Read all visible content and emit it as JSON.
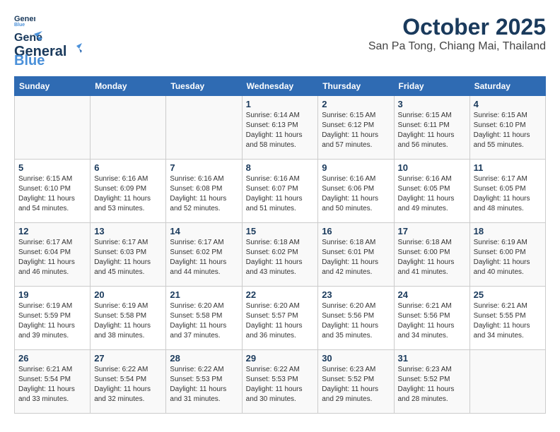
{
  "header": {
    "logo_line1": "General",
    "logo_line2": "Blue",
    "title": "October 2025",
    "subtitle": "San Pa Tong, Chiang Mai, Thailand"
  },
  "calendar": {
    "days_of_week": [
      "Sunday",
      "Monday",
      "Tuesday",
      "Wednesday",
      "Thursday",
      "Friday",
      "Saturday"
    ],
    "weeks": [
      [
        {
          "day": "",
          "info": ""
        },
        {
          "day": "",
          "info": ""
        },
        {
          "day": "",
          "info": ""
        },
        {
          "day": "1",
          "info": "Sunrise: 6:14 AM\nSunset: 6:13 PM\nDaylight: 11 hours\nand 58 minutes."
        },
        {
          "day": "2",
          "info": "Sunrise: 6:15 AM\nSunset: 6:12 PM\nDaylight: 11 hours\nand 57 minutes."
        },
        {
          "day": "3",
          "info": "Sunrise: 6:15 AM\nSunset: 6:11 PM\nDaylight: 11 hours\nand 56 minutes."
        },
        {
          "day": "4",
          "info": "Sunrise: 6:15 AM\nSunset: 6:10 PM\nDaylight: 11 hours\nand 55 minutes."
        }
      ],
      [
        {
          "day": "5",
          "info": "Sunrise: 6:15 AM\nSunset: 6:10 PM\nDaylight: 11 hours\nand 54 minutes."
        },
        {
          "day": "6",
          "info": "Sunrise: 6:16 AM\nSunset: 6:09 PM\nDaylight: 11 hours\nand 53 minutes."
        },
        {
          "day": "7",
          "info": "Sunrise: 6:16 AM\nSunset: 6:08 PM\nDaylight: 11 hours\nand 52 minutes."
        },
        {
          "day": "8",
          "info": "Sunrise: 6:16 AM\nSunset: 6:07 PM\nDaylight: 11 hours\nand 51 minutes."
        },
        {
          "day": "9",
          "info": "Sunrise: 6:16 AM\nSunset: 6:06 PM\nDaylight: 11 hours\nand 50 minutes."
        },
        {
          "day": "10",
          "info": "Sunrise: 6:16 AM\nSunset: 6:05 PM\nDaylight: 11 hours\nand 49 minutes."
        },
        {
          "day": "11",
          "info": "Sunrise: 6:17 AM\nSunset: 6:05 PM\nDaylight: 11 hours\nand 48 minutes."
        }
      ],
      [
        {
          "day": "12",
          "info": "Sunrise: 6:17 AM\nSunset: 6:04 PM\nDaylight: 11 hours\nand 46 minutes."
        },
        {
          "day": "13",
          "info": "Sunrise: 6:17 AM\nSunset: 6:03 PM\nDaylight: 11 hours\nand 45 minutes."
        },
        {
          "day": "14",
          "info": "Sunrise: 6:17 AM\nSunset: 6:02 PM\nDaylight: 11 hours\nand 44 minutes."
        },
        {
          "day": "15",
          "info": "Sunrise: 6:18 AM\nSunset: 6:02 PM\nDaylight: 11 hours\nand 43 minutes."
        },
        {
          "day": "16",
          "info": "Sunrise: 6:18 AM\nSunset: 6:01 PM\nDaylight: 11 hours\nand 42 minutes."
        },
        {
          "day": "17",
          "info": "Sunrise: 6:18 AM\nSunset: 6:00 PM\nDaylight: 11 hours\nand 41 minutes."
        },
        {
          "day": "18",
          "info": "Sunrise: 6:19 AM\nSunset: 6:00 PM\nDaylight: 11 hours\nand 40 minutes."
        }
      ],
      [
        {
          "day": "19",
          "info": "Sunrise: 6:19 AM\nSunset: 5:59 PM\nDaylight: 11 hours\nand 39 minutes."
        },
        {
          "day": "20",
          "info": "Sunrise: 6:19 AM\nSunset: 5:58 PM\nDaylight: 11 hours\nand 38 minutes."
        },
        {
          "day": "21",
          "info": "Sunrise: 6:20 AM\nSunset: 5:58 PM\nDaylight: 11 hours\nand 37 minutes."
        },
        {
          "day": "22",
          "info": "Sunrise: 6:20 AM\nSunset: 5:57 PM\nDaylight: 11 hours\nand 36 minutes."
        },
        {
          "day": "23",
          "info": "Sunrise: 6:20 AM\nSunset: 5:56 PM\nDaylight: 11 hours\nand 35 minutes."
        },
        {
          "day": "24",
          "info": "Sunrise: 6:21 AM\nSunset: 5:56 PM\nDaylight: 11 hours\nand 34 minutes."
        },
        {
          "day": "25",
          "info": "Sunrise: 6:21 AM\nSunset: 5:55 PM\nDaylight: 11 hours\nand 34 minutes."
        }
      ],
      [
        {
          "day": "26",
          "info": "Sunrise: 6:21 AM\nSunset: 5:54 PM\nDaylight: 11 hours\nand 33 minutes."
        },
        {
          "day": "27",
          "info": "Sunrise: 6:22 AM\nSunset: 5:54 PM\nDaylight: 11 hours\nand 32 minutes."
        },
        {
          "day": "28",
          "info": "Sunrise: 6:22 AM\nSunset: 5:53 PM\nDaylight: 11 hours\nand 31 minutes."
        },
        {
          "day": "29",
          "info": "Sunrise: 6:22 AM\nSunset: 5:53 PM\nDaylight: 11 hours\nand 30 minutes."
        },
        {
          "day": "30",
          "info": "Sunrise: 6:23 AM\nSunset: 5:52 PM\nDaylight: 11 hours\nand 29 minutes."
        },
        {
          "day": "31",
          "info": "Sunrise: 6:23 AM\nSunset: 5:52 PM\nDaylight: 11 hours\nand 28 minutes."
        },
        {
          "day": "",
          "info": ""
        }
      ]
    ]
  }
}
